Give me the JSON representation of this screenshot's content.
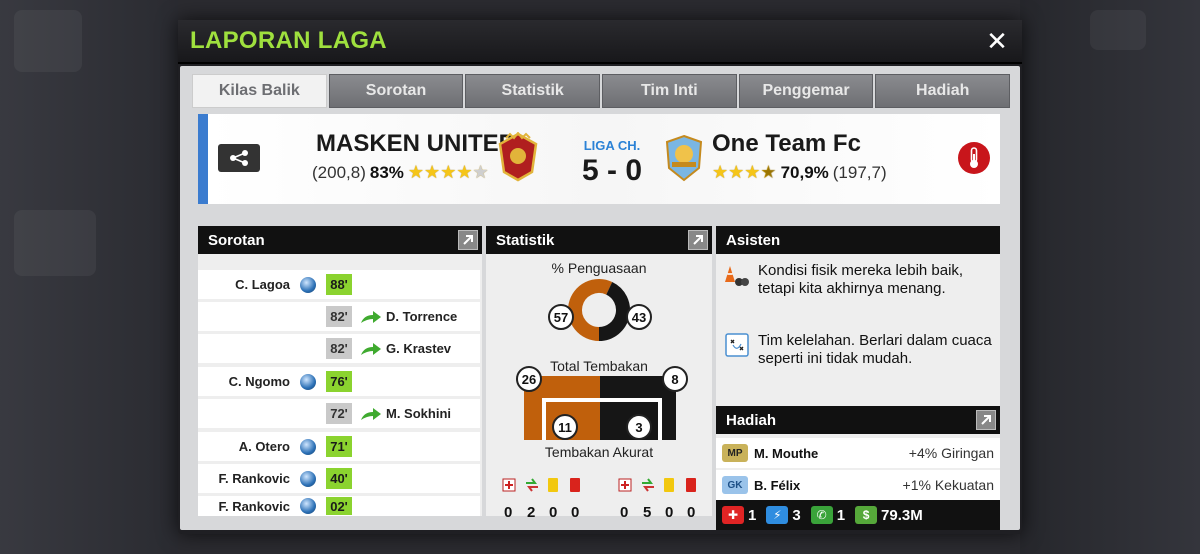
{
  "modal": {
    "title": "LAPORAN LAGA",
    "close_label": "✕"
  },
  "tabs": [
    {
      "label": "Kilas Balik",
      "active": true
    },
    {
      "label": "Sorotan",
      "active": false
    },
    {
      "label": "Statistik",
      "active": false
    },
    {
      "label": "Tim Inti",
      "active": false
    },
    {
      "label": "Penggemar",
      "active": false
    },
    {
      "label": "Hadiah",
      "active": false
    }
  ],
  "match": {
    "home": {
      "name": "MASKEN UNITED",
      "rating": "(200,8)",
      "pct": "83%",
      "stars": 4
    },
    "away": {
      "name": "One Team Fc",
      "rating": "(197,7)",
      "pct": "70,9%",
      "stars": 3.5
    },
    "league": "LIGA CH.",
    "score": "5 - 0"
  },
  "highlights": {
    "title": "Sorotan",
    "rows": [
      {
        "type": "goal",
        "side": "home",
        "player": "C. Lagoa",
        "minute": "88'"
      },
      {
        "type": "sub",
        "side": "away",
        "player": "D. Torrence",
        "minute": "82'"
      },
      {
        "type": "sub",
        "side": "away",
        "player": "G. Krastev",
        "minute": "82'"
      },
      {
        "type": "goal",
        "side": "home",
        "player": "C. Ngomo",
        "minute": "76'"
      },
      {
        "type": "sub",
        "side": "away",
        "player": "M. Sokhini",
        "minute": "72'"
      },
      {
        "type": "goal",
        "side": "home",
        "player": "A. Otero",
        "minute": "71'"
      },
      {
        "type": "goal",
        "side": "home",
        "player": "F. Rankovic",
        "minute": "40'"
      },
      {
        "type": "goal",
        "side": "home",
        "player": "F. Rankovic",
        "minute": "02'"
      }
    ]
  },
  "stats": {
    "title": "Statistik",
    "possession_label": "% Penguasaan",
    "possession_home": "57",
    "possession_away": "43",
    "shots_label": "Total Tembakan",
    "shots_home": "26",
    "shots_away": "8",
    "accurate_label": "Tembakan Akurat",
    "accurate_home": "11",
    "accurate_away": "3",
    "cards_home": [
      "0",
      "2",
      "0",
      "0"
    ],
    "cards_away": [
      "0",
      "5",
      "0",
      "0"
    ],
    "home_color": "#c0600c",
    "away_color": "#161616"
  },
  "assistant": {
    "title": "Asisten",
    "lines": [
      {
        "icon": "cones-icon",
        "text": "Kondisi fisik mereka lebih baik, tetapi kita akhirnya menang."
      },
      {
        "icon": "tactics-board-icon",
        "text": "Tim kelelahan. Berlari dalam cuaca seperti ini tidak mudah."
      }
    ]
  },
  "rewards": {
    "title": "Hadiah",
    "rows": [
      {
        "badge": "MP",
        "player": "M. Mouthe",
        "value": "+4% Giringan"
      },
      {
        "badge": "GK",
        "player": "B. Félix",
        "value": "+1% Kekuatan"
      }
    ],
    "bonus": {
      "medical": "1",
      "energy": "3",
      "chat": "1",
      "money": "79.3M"
    }
  }
}
